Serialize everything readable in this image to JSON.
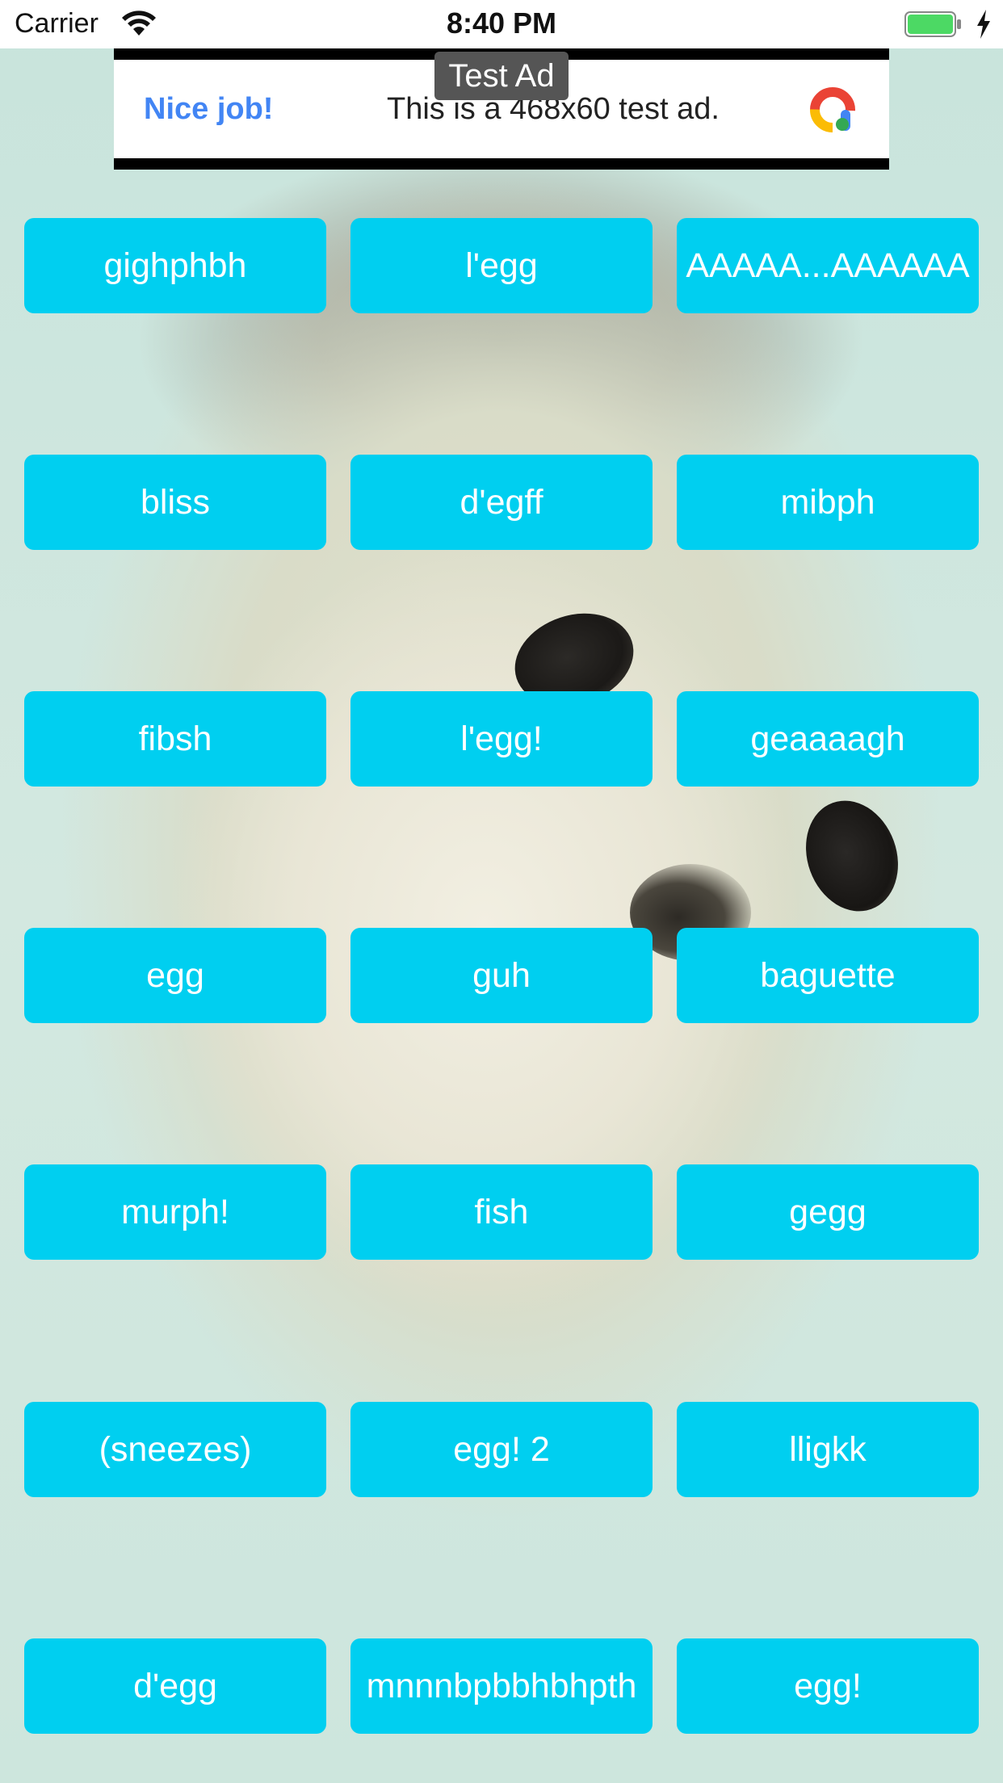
{
  "status_bar": {
    "carrier": "Carrier",
    "time": "8:40 PM",
    "icons": [
      "wifi-icon",
      "battery-icon",
      "charging-icon"
    ],
    "battery_color": "#4cd964"
  },
  "ad": {
    "badge": "Test Ad",
    "headline": "Nice job!",
    "description": "This is a 468x60 test ad.",
    "headline_color": "#4285f4",
    "logo_icon": "google-ad-logo-icon"
  },
  "theme": {
    "button_color": "#00cff0",
    "button_text_color": "#ffffff"
  },
  "buttons": [
    [
      "gighphbh",
      "l'egg",
      "AAAAA...AAAAAA"
    ],
    [
      "bliss",
      "d'egff",
      "mibph"
    ],
    [
      "fibsh",
      "l'egg!",
      "geaaaagh"
    ],
    [
      "egg",
      "guh",
      "baguette"
    ],
    [
      "murph!",
      "fish",
      "gegg"
    ],
    [
      "(sneezes)",
      "egg! 2",
      "lligkk"
    ],
    [
      "d'egg",
      "mnnnbpbbhbhpth",
      "egg!"
    ]
  ]
}
